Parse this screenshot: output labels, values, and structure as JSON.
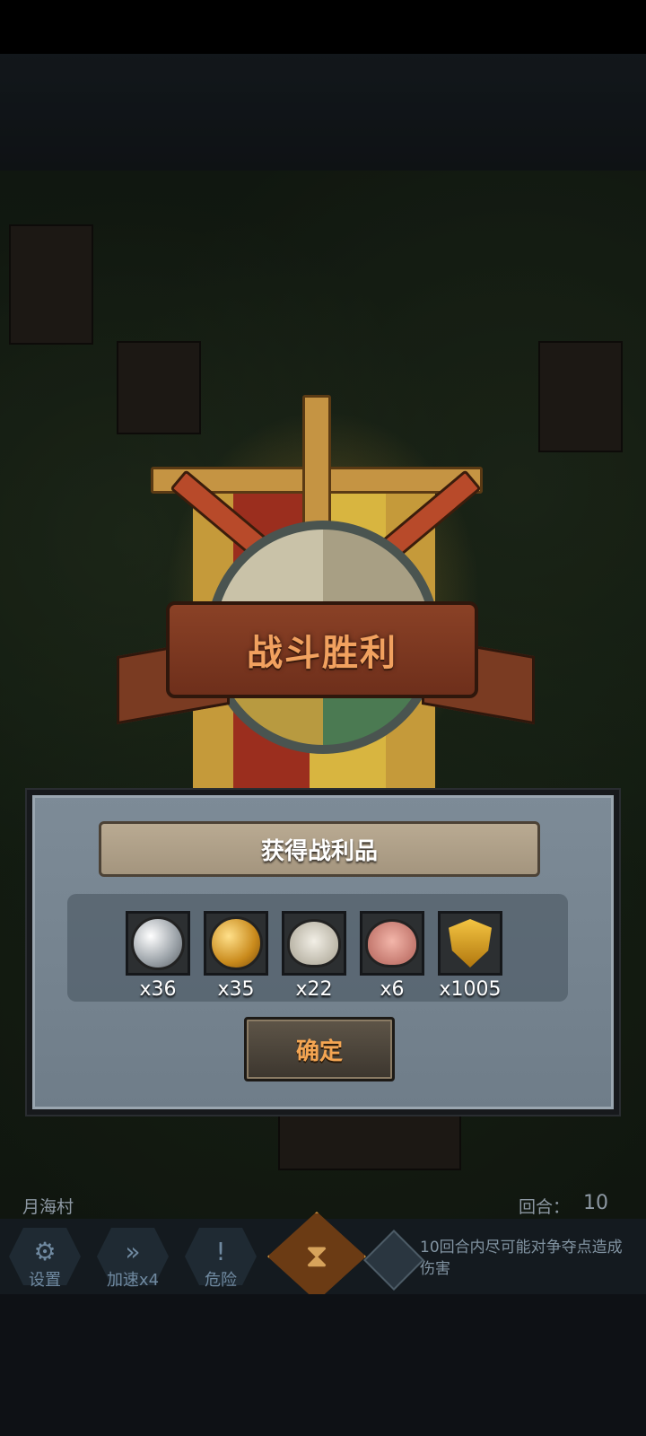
{
  "banner": {
    "title": "战斗胜利"
  },
  "dialog": {
    "title": "获得战利品",
    "rewards": [
      {
        "name": "silver-coin",
        "icon": "silver-coin-icon",
        "qty": "x36"
      },
      {
        "name": "gold-coin",
        "icon": "gold-coin-icon",
        "qty": "x35"
      },
      {
        "name": "sheep",
        "icon": "sheep-icon",
        "qty": "x22"
      },
      {
        "name": "pig",
        "icon": "pig-icon",
        "qty": "x6"
      },
      {
        "name": "honor-crest",
        "icon": "crest-icon",
        "qty": "x1005"
      }
    ],
    "confirm_label": "确定"
  },
  "hud": {
    "village": "月海村",
    "round_label": "回合：",
    "round_value": "10",
    "settings_label": "设置",
    "speed_label": "加速x4",
    "danger_label": "危险",
    "objective": "10回合内尽可能对争夺点造成伤害"
  }
}
